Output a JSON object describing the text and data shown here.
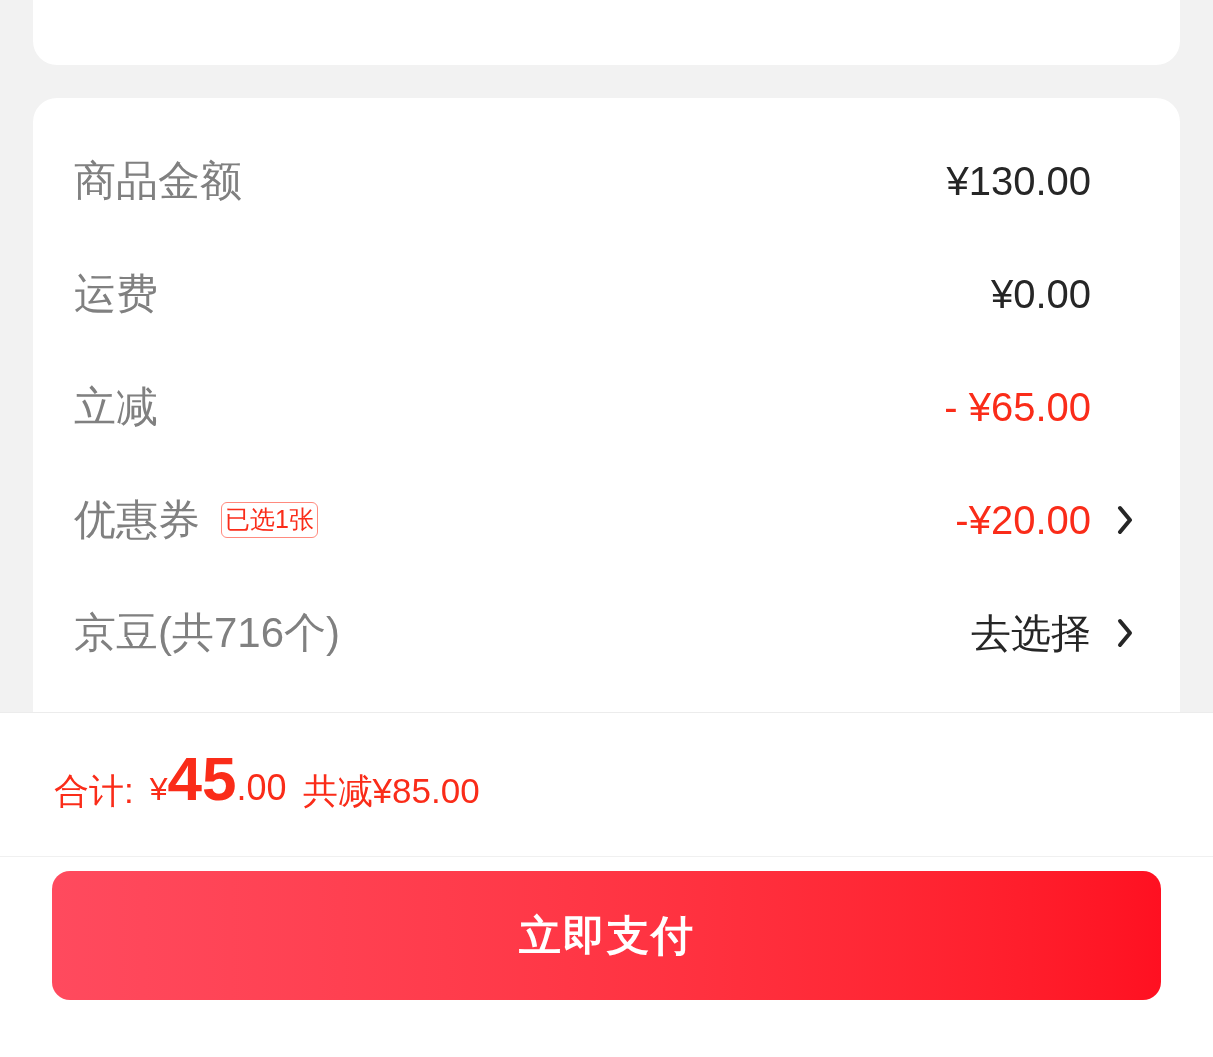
{
  "summary_rows": [
    {
      "label": "商品金额",
      "value": "¥130.00",
      "kind": "amount",
      "chevron": false
    },
    {
      "label": "运费",
      "value": "¥0.00",
      "kind": "amount",
      "chevron": false
    },
    {
      "label": "立减",
      "value": "- ¥65.00",
      "kind": "discount",
      "chevron": false
    },
    {
      "label": "优惠券",
      "badge": "已选1张",
      "value": "-¥20.00",
      "kind": "discount",
      "chevron": true
    },
    {
      "label": "京豆(共716个)",
      "value": "去选择",
      "kind": "action",
      "chevron": true
    }
  ],
  "total_bar": {
    "label": "合计:",
    "currency": "¥",
    "amount_integer": "45",
    "amount_decimal": ".00",
    "savings": "共减¥85.00"
  },
  "pay_button": {
    "label": "立即支付"
  }
}
